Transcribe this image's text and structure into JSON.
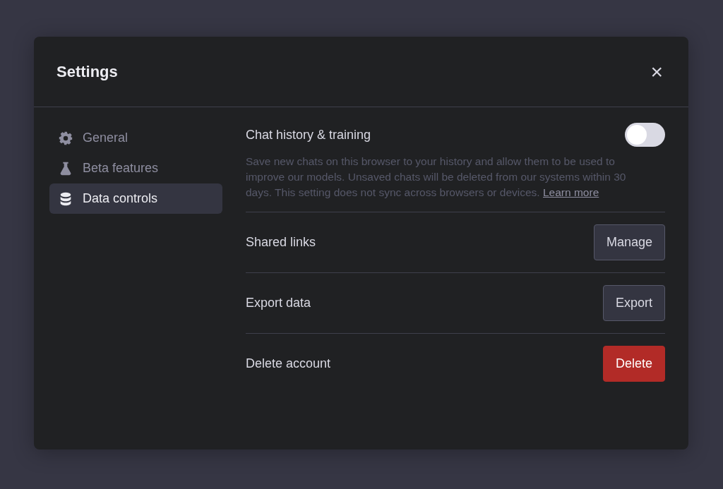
{
  "dialog": {
    "title": "Settings",
    "close_icon": "×"
  },
  "sidebar": {
    "items": [
      {
        "label": "General",
        "kind": "gear",
        "selected": false
      },
      {
        "label": "Beta features",
        "kind": "flask",
        "selected": false
      },
      {
        "label": "Data controls",
        "kind": "database",
        "selected": true
      }
    ]
  },
  "settings": [
    {
      "kind": "toggle",
      "label": "Chat history & training",
      "on": false,
      "description": "Save new chats on this browser to your history and allow them to be used to improve our models. Unsaved chats will be deleted from our systems within 30 days. This setting does not sync across browsers or devices.",
      "link": "Learn more"
    },
    {
      "kind": "action",
      "label": "Shared links",
      "button": "Manage"
    },
    {
      "kind": "action",
      "label": "Export data",
      "button": "Export"
    },
    {
      "kind": "danger",
      "label": "Delete account",
      "button": "Delete"
    }
  ]
}
